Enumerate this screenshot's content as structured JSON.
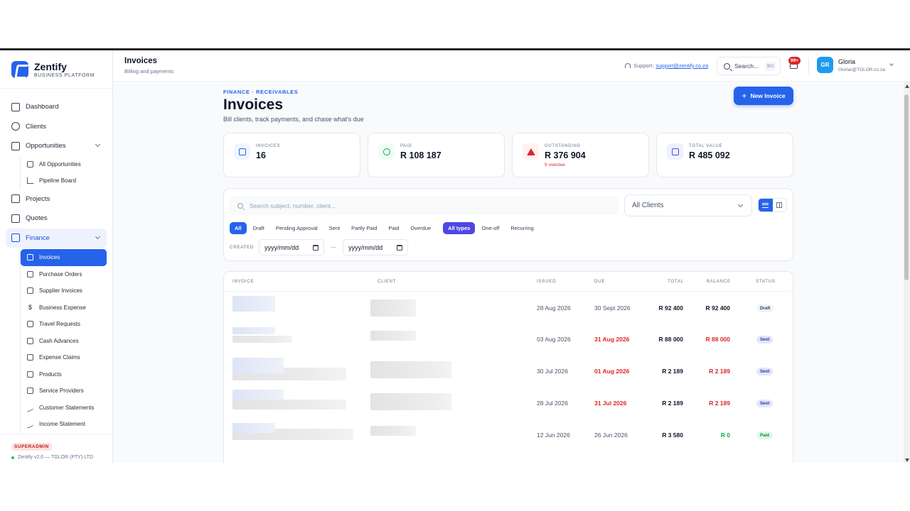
{
  "brand": {
    "name": "Zentify",
    "tagline": "BUSINESS PLATFORM"
  },
  "sidebar": {
    "items": [
      {
        "label": "Dashboard",
        "icon": "dashboard-icon"
      },
      {
        "label": "Clients",
        "icon": "users-icon"
      },
      {
        "label": "Opportunities",
        "icon": "briefcase-icon"
      },
      {
        "label": "Projects",
        "icon": "folder-icon"
      },
      {
        "label": "Quotes",
        "icon": "document-icon"
      },
      {
        "label": "Finance",
        "icon": "credit-card-icon"
      }
    ],
    "opportunities_sub": [
      "All Opportunities",
      "Pipeline Board"
    ],
    "finance_sub": [
      "Invoices",
      "Purchase Orders",
      "Supplier Invoices",
      "Business Expense",
      "Travel Requests",
      "Cash Advances",
      "Expense Claims",
      "Products",
      "Service Providers",
      "Customer Statements",
      "Income Statement"
    ],
    "role": "SUPERADMIN",
    "version": "Zentify v2.0 — TGLOR (PTY) LTD"
  },
  "header": {
    "title": "Invoices",
    "subtitle": "Billing and payments",
    "support_label": "Support:",
    "support_email": "support@zentify.co.za",
    "search_label": "Search...",
    "search_kbd": "⌘K",
    "notif_count": "99+",
    "user_initials": "GR",
    "user_name": "Gloria",
    "user_email": "Gloriar@TGLOR.co.za"
  },
  "page": {
    "crumb": "FINANCE · RECEIVABLES",
    "title": "Invoices",
    "subtitle": "Bill clients, track payments, and chase what's due",
    "new_button": "New Invoice"
  },
  "stats": [
    {
      "label": "INVOICES",
      "value": "16",
      "note": "",
      "color": "#2563eb",
      "bg": "#eff6ff"
    },
    {
      "label": "PAID",
      "value": "R 108 187",
      "note": "",
      "color": "#16a34a",
      "bg": "#f0fdf4"
    },
    {
      "label": "OUTSTANDING",
      "value": "R 376 904",
      "note": "9 overdue",
      "color": "#dc2626",
      "bg": "#fef2f2"
    },
    {
      "label": "TOTAL VALUE",
      "value": "R 485 092",
      "note": "",
      "color": "#4f46e5",
      "bg": "#eef2ff"
    }
  ],
  "filters": {
    "search_placeholder": "Search subject, number, client...",
    "client_select": "All Clients",
    "status_chips": [
      "All",
      "Draft",
      "Pending Approval",
      "Sent",
      "Partly Paid",
      "Paid",
      "Overdue"
    ],
    "type_chips": [
      "All types",
      "One-off",
      "Recurring"
    ],
    "created_label": "CREATED",
    "date_from": "yyyy/mm/dd",
    "date_to": "yyyy/mm/dd"
  },
  "table": {
    "columns": [
      "INVOICE",
      "CLIENT",
      "ISSUED",
      "DUE",
      "TOTAL",
      "BALANCE",
      "STATUS"
    ],
    "rows": [
      {
        "issued": "28 Aug 2026",
        "due": "30 Sept 2026",
        "due_overdue": false,
        "total": "R 92 400",
        "balance": "R 92 400",
        "balance_color": "#0f172a",
        "status": "Draft",
        "status_class": "b-draft"
      },
      {
        "issued": "03 Aug 2026",
        "due": "31 Aug 2026",
        "due_overdue": true,
        "total": "R 88 000",
        "balance": "R 88 000",
        "balance_color": "#dc2626",
        "status": "Sent",
        "status_class": "b-sent"
      },
      {
        "issued": "30 Jul 2026",
        "due": "01 Aug 2026",
        "due_overdue": true,
        "total": "R 2 189",
        "balance": "R 2 189",
        "balance_color": "#dc2626",
        "status": "Sent",
        "status_class": "b-sent"
      },
      {
        "issued": "28 Jul 2026",
        "due": "31 Jul 2026",
        "due_overdue": true,
        "total": "R 2 189",
        "balance": "R 2 189",
        "balance_color": "#dc2626",
        "status": "Sent",
        "status_class": "b-sent"
      },
      {
        "issued": "12 Jun 2026",
        "due": "26 Jun 2026",
        "due_overdue": false,
        "total": "R 3 580",
        "balance": "R 0",
        "balance_color": "#16a34a",
        "status": "Paid",
        "status_class": "b-paid"
      }
    ]
  }
}
